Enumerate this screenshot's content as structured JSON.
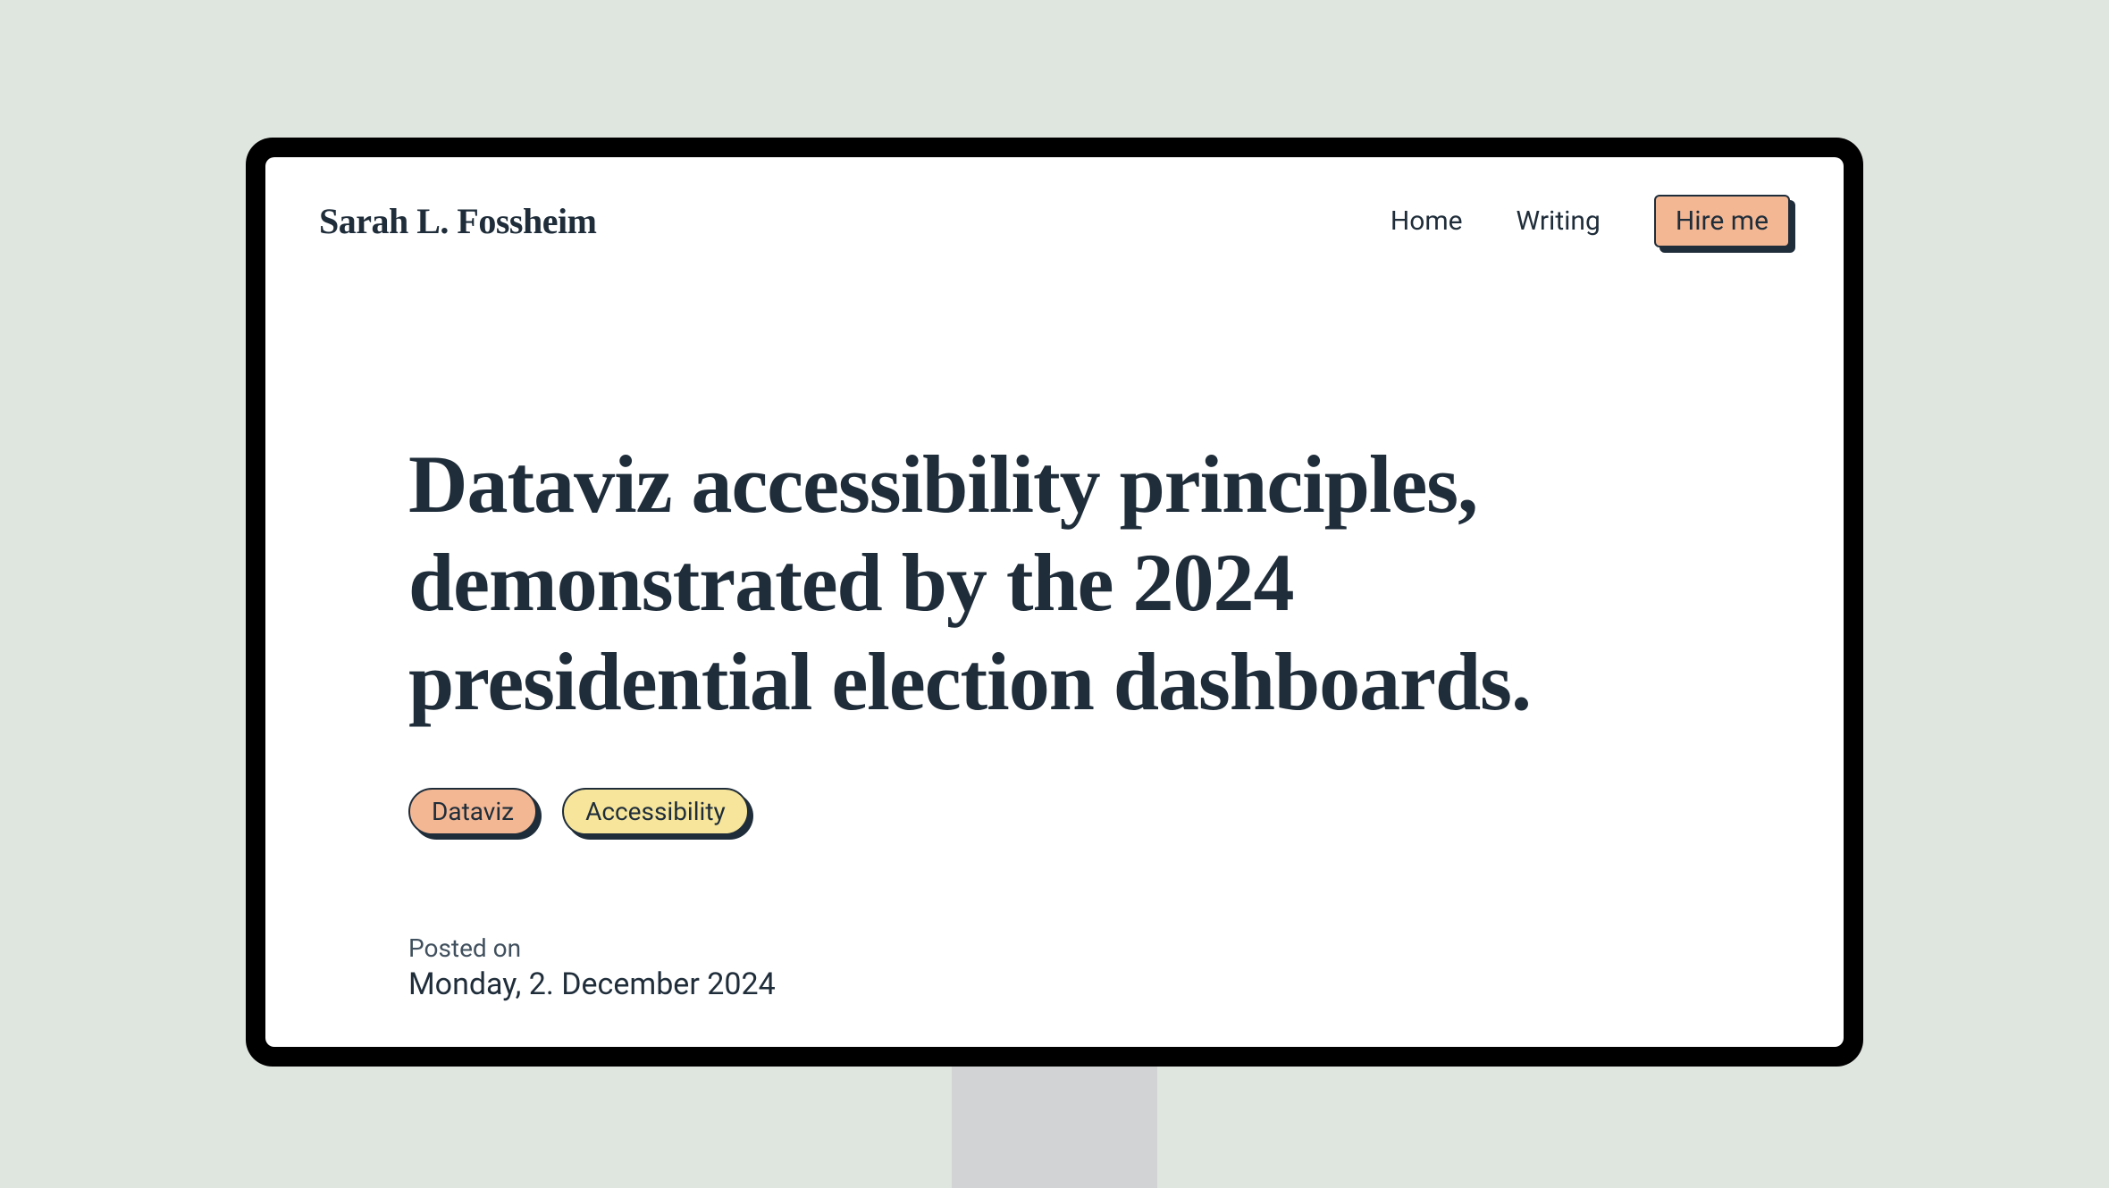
{
  "brand": "Sarah L. Fossheim",
  "nav": {
    "home": "Home",
    "writing": "Writing",
    "hire": "Hire me"
  },
  "article": {
    "title": "Dataviz accessibility principles, demonstrated by the 2024 presidential election dashboards.",
    "tags": [
      {
        "label": "Dataviz",
        "color": "apricot"
      },
      {
        "label": "Accessibility",
        "color": "lemon"
      }
    ],
    "posted_label": "Posted on",
    "posted_date": "Monday, 2. December 2024"
  },
  "colors": {
    "background": "#dfe5df",
    "ink": "#1f2d3a",
    "apricot": "#f3b794",
    "lemon": "#f6e59a"
  }
}
